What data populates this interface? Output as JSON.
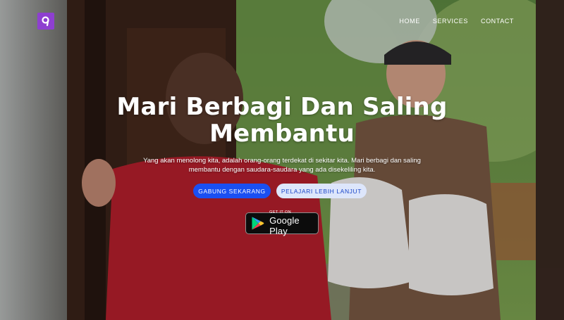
{
  "nav": {
    "items": [
      {
        "label": "HOME"
      },
      {
        "label": "SERVICES"
      },
      {
        "label": "CONTACT"
      }
    ]
  },
  "hero": {
    "headline": "Mari Berbagi Dan Saling Membantu",
    "description": "Yang akan menolong kita, adalah orang-orang terdekat di sekitar kita. Mari berbagi dan saling membantu dengan saudara-saudara yang ada disekeliling kita.",
    "primary_button": "GABUNG SEKARANG",
    "secondary_button": "PELAJARI LEBIH LANJUT"
  },
  "play_badge": {
    "top_line": "GET IT ON",
    "store_name": "Google Play"
  },
  "colors": {
    "brand_logo": "#8e3fd0",
    "primary_button": "#1a4ff2",
    "secondary_button": "#dde6fb",
    "nav_text": "#ffffff"
  },
  "icons": {
    "logo": "brand-logo-icon",
    "play": "google-play-icon"
  }
}
